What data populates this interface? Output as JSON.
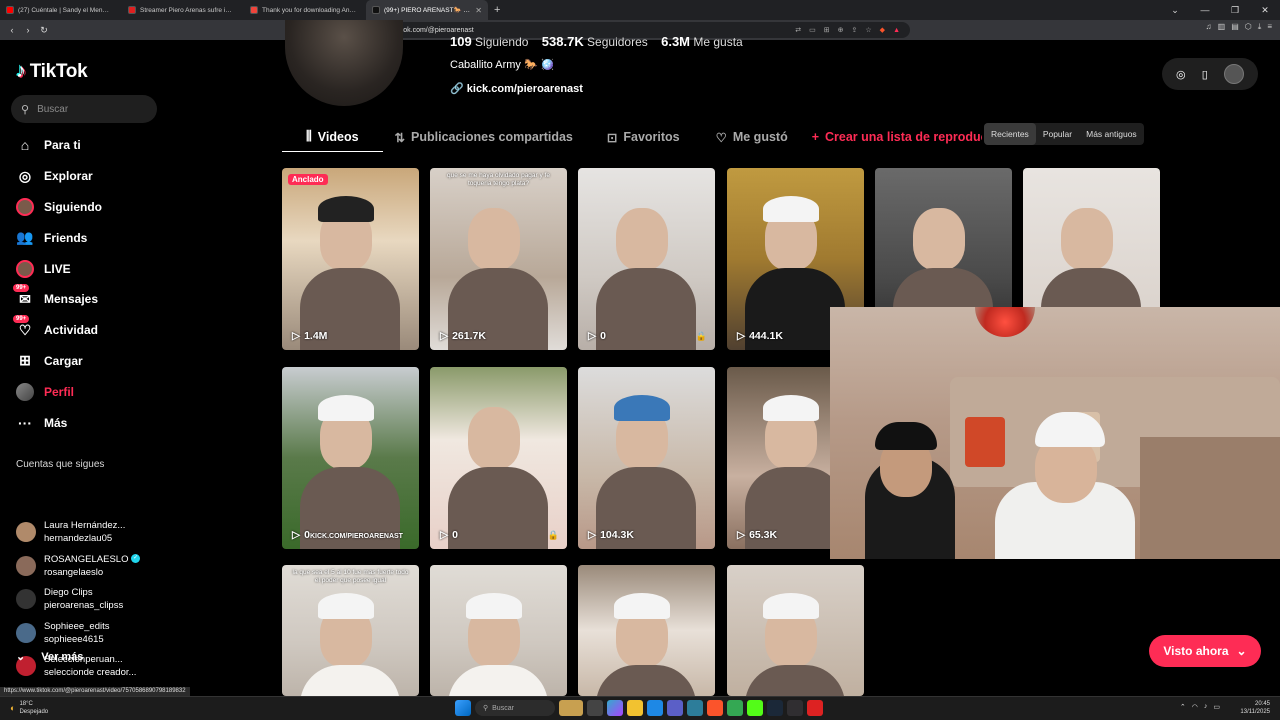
{
  "browser": {
    "tabs": [
      {
        "title": "(27) Cuéntale | Sandy el Menor (Aud",
        "color": "#ff0000",
        "active": false
      },
      {
        "title": "Streamer Piero Arenas sufre intento",
        "color": "#e02020",
        "active": false
      },
      {
        "title": "Thank you for downloading AnyDesk",
        "color": "#ef443b",
        "active": false
      },
      {
        "title": "(99+) PIERO ARENAST🐎 (@piero",
        "color": "#111111",
        "active": true
      }
    ],
    "url": "tiktok.com/@pieroarenast",
    "status_url": "https://www.tiktok.com/@pieroarenast/video/7570586890798189832"
  },
  "sidebar": {
    "logo": "TikTok",
    "search_placeholder": "Buscar",
    "items": [
      {
        "label": "Para ti",
        "icon": "home-icon",
        "glyph": "⌂"
      },
      {
        "label": "Explorar",
        "icon": "compass-icon",
        "glyph": "◎"
      },
      {
        "label": "Siguiendo",
        "icon": "following-avatar-icon",
        "glyph": "●"
      },
      {
        "label": "Friends",
        "icon": "friends-icon",
        "glyph": "👥"
      },
      {
        "label": "LIVE",
        "icon": "live-icon",
        "glyph": "◉"
      },
      {
        "label": "Mensajes",
        "icon": "messages-icon",
        "glyph": "✉",
        "badge": "99+"
      },
      {
        "label": "Actividad",
        "icon": "activity-icon",
        "glyph": "♡",
        "badge": "99+"
      },
      {
        "label": "Cargar",
        "icon": "upload-icon",
        "glyph": "⊞"
      },
      {
        "label": "Perfil",
        "icon": "profile-avatar-icon",
        "glyph": ""
      },
      {
        "label": "Más",
        "icon": "more-icon",
        "glyph": "···"
      }
    ],
    "following_title": "Cuentas que sigues",
    "following": [
      {
        "name": "Laura Hernández...",
        "handle": "hernandezlau05",
        "color": "#b08a6a",
        "verified": false
      },
      {
        "name": "ROSANGELAESLO",
        "handle": "rosangelaeslo",
        "color": "#8a6a5a",
        "verified": true
      },
      {
        "name": "Diego Clips",
        "handle": "pieroarenas_clipss",
        "color": "#333333",
        "verified": false
      },
      {
        "name": "Sophieee_edits",
        "handle": "sophieee4615",
        "color": "#4a6a8a",
        "verified": false
      },
      {
        "name": "Seleccionperuan...",
        "handle": "seleccionde creador...",
        "color": "#c02030",
        "verified": false
      }
    ],
    "ver_mas": "Ver más"
  },
  "profile": {
    "following_count": "109",
    "following_label": "Siguiendo",
    "followers_count": "538.7K",
    "followers_label": "Seguidores",
    "likes_count": "6.3M",
    "likes_label": "Me gusta",
    "bio": "Caballito Army 🐎 🪩",
    "link": "kick.com/pieroarenast"
  },
  "tabs": {
    "videos": "Videos",
    "shared": "Publicaciones compartidas",
    "favorites": "Favoritos",
    "liked": "Me gustó",
    "create": "Crear una lista de reproducción"
  },
  "sort": {
    "recent": "Recientes",
    "popular": "Popular",
    "oldest": "Más antiguos"
  },
  "videos": [
    {
      "views": "1.4M",
      "pinned": "Anclado",
      "locked": false,
      "caption": ""
    },
    {
      "views": "261.7K",
      "locked": false,
      "caption": "que se me haya olvidado pagar y fe toqueria tengo plata?"
    },
    {
      "views": "0",
      "locked": true,
      "caption": ""
    },
    {
      "views": "444.1K",
      "locked": false,
      "caption": ""
    },
    {
      "views": "",
      "locked": false,
      "caption": ""
    },
    {
      "views": "",
      "locked": false,
      "caption": ""
    },
    {
      "views": "0",
      "locked": false,
      "caption": "KICK.COM/PIEROARENAST"
    },
    {
      "views": "0",
      "locked": true,
      "caption": ""
    },
    {
      "views": "104.3K",
      "locked": false,
      "caption": ""
    },
    {
      "views": "65.3K",
      "locked": false,
      "caption": ""
    },
    {
      "views": "",
      "locked": false,
      "caption": ""
    },
    {
      "views": "",
      "locked": false,
      "caption": ""
    },
    {
      "views": "",
      "locked": false,
      "caption": "la que sea el 5 al 10 fue mas fuerte todo el poder que posee igual"
    },
    {
      "views": "",
      "locked": false,
      "caption": ""
    },
    {
      "views": "",
      "locked": false,
      "caption": ""
    },
    {
      "views": "",
      "locked": false,
      "caption": ""
    }
  ],
  "visto_ahora": "Visto ahora",
  "taskbar": {
    "temp": "18°C",
    "weather": "Despejado",
    "search": "Buscar",
    "time": "20:45",
    "date": "13/11/2025"
  },
  "colors": {
    "accent": "#fe2c55",
    "bg": "#000000",
    "panel": "#1f1f1f"
  }
}
